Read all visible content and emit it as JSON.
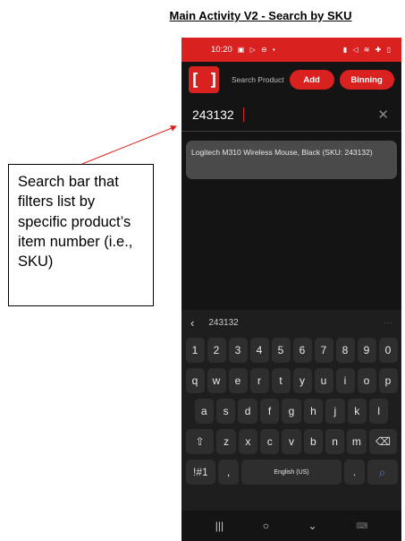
{
  "page": {
    "title": "Main Activity V2 - Search by SKU"
  },
  "callout": {
    "text": "Search bar that filters list by specific product’s item number (i.e., SKU)"
  },
  "status_bar": {
    "time": "10:20",
    "left_icons": "▣ ▷ ⊖ •",
    "right_icons": "▮ ◁ ≋ ✚ ▯"
  },
  "header": {
    "label": "Search Product",
    "add_label": "Add",
    "binning_label": "Binning",
    "accent_color": "#d9211f"
  },
  "search": {
    "value": "243132",
    "clear_icon": "close-icon"
  },
  "results": [
    {
      "text": "Logitech M310 Wireless Mouse, Black (SKU: 243132)"
    }
  ],
  "keyboard": {
    "suggestion": "243132",
    "rows": [
      [
        "1",
        "2",
        "3",
        "4",
        "5",
        "6",
        "7",
        "8",
        "9",
        "0"
      ],
      [
        "q",
        "w",
        "e",
        "r",
        "t",
        "y",
        "u",
        "i",
        "o",
        "p"
      ],
      [
        "a",
        "s",
        "d",
        "f",
        "g",
        "h",
        "j",
        "k",
        "l"
      ],
      [
        "⇧",
        "z",
        "x",
        "c",
        "v",
        "b",
        "n",
        "m",
        "⌫"
      ]
    ],
    "bottom": {
      "symbols": "!#1",
      "comma": ",",
      "space": "English (US)",
      "period": ".",
      "go": "⌕"
    }
  },
  "nav_bar": {
    "recents": "|||",
    "home": "○",
    "back": "⌄",
    "keyboard": "⌨"
  }
}
